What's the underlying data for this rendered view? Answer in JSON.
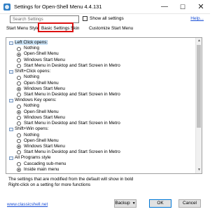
{
  "window": {
    "title": "Settings for Open-Shell Menu 4.4.131",
    "controls": {
      "minimize": "—",
      "maximize": "☐",
      "close": "✕"
    },
    "icon": "app-icon"
  },
  "toolbar": {
    "search_placeholder": "Search Settings",
    "show_all_label": "Show all settings",
    "show_all_checked": false,
    "help_label": "Help..."
  },
  "tabs": [
    {
      "label": "Start Menu Style",
      "active": false
    },
    {
      "label": "Basic Settings",
      "active": true
    },
    {
      "label": "Skin",
      "active": false
    },
    {
      "label": "Customize Start Menu",
      "active": false
    }
  ],
  "settings": {
    "rows": [
      {
        "type": "header",
        "label": "Left Click opens:",
        "highlight": true
      },
      {
        "type": "option",
        "label": "Nothing",
        "selected": false
      },
      {
        "type": "option",
        "label": "Open-Shell Menu",
        "selected": true
      },
      {
        "type": "option",
        "label": "Windows Start Menu",
        "selected": false
      },
      {
        "type": "option",
        "label": "Start Menu in Desktop and Start Screen in Metro",
        "selected": false
      },
      {
        "type": "header",
        "label": "Shift+Click opens:",
        "highlight": false
      },
      {
        "type": "option",
        "label": "Nothing",
        "selected": false
      },
      {
        "type": "option",
        "label": "Open-Shell Menu",
        "selected": false
      },
      {
        "type": "option",
        "label": "Windows Start Menu",
        "selected": true
      },
      {
        "type": "option",
        "label": "Start Menu in Desktop and Start Screen in Metro",
        "selected": false
      },
      {
        "type": "header",
        "label": "Windows Key opens:",
        "highlight": false
      },
      {
        "type": "option",
        "label": "Nothing",
        "selected": false
      },
      {
        "type": "option",
        "label": "Open-Shell Menu",
        "selected": true
      },
      {
        "type": "option",
        "label": "Windows Start Menu",
        "selected": false
      },
      {
        "type": "option",
        "label": "Start Menu in Desktop and Start Screen in Metro",
        "selected": false
      },
      {
        "type": "header",
        "label": "Shift+Win opens:",
        "highlight": false
      },
      {
        "type": "option",
        "label": "Nothing",
        "selected": false
      },
      {
        "type": "option",
        "label": "Open-Shell Menu",
        "selected": false
      },
      {
        "type": "option",
        "label": "Windows Start Menu",
        "selected": true
      },
      {
        "type": "option",
        "label": "Start Menu in Desktop and Start Screen in Metro",
        "selected": false
      },
      {
        "type": "header",
        "label": "All Programs style",
        "highlight": false
      },
      {
        "type": "option",
        "label": "Cascading sub-menu",
        "selected": false
      },
      {
        "type": "option",
        "label": "Inside main menu",
        "selected": true
      }
    ]
  },
  "footer": {
    "line1": "The settings that are modified from the default will show in bold",
    "line2": "Right-click on a setting for more functions"
  },
  "bottom": {
    "link_label": "www.classicshell.net",
    "backup_label": "Backup",
    "ok_label": "OK",
    "cancel_label": "Cancel"
  },
  "colors": {
    "tab_highlight_border": "#d11111",
    "link": "#1a4fd6",
    "row_highlight": "#cce4f7"
  }
}
